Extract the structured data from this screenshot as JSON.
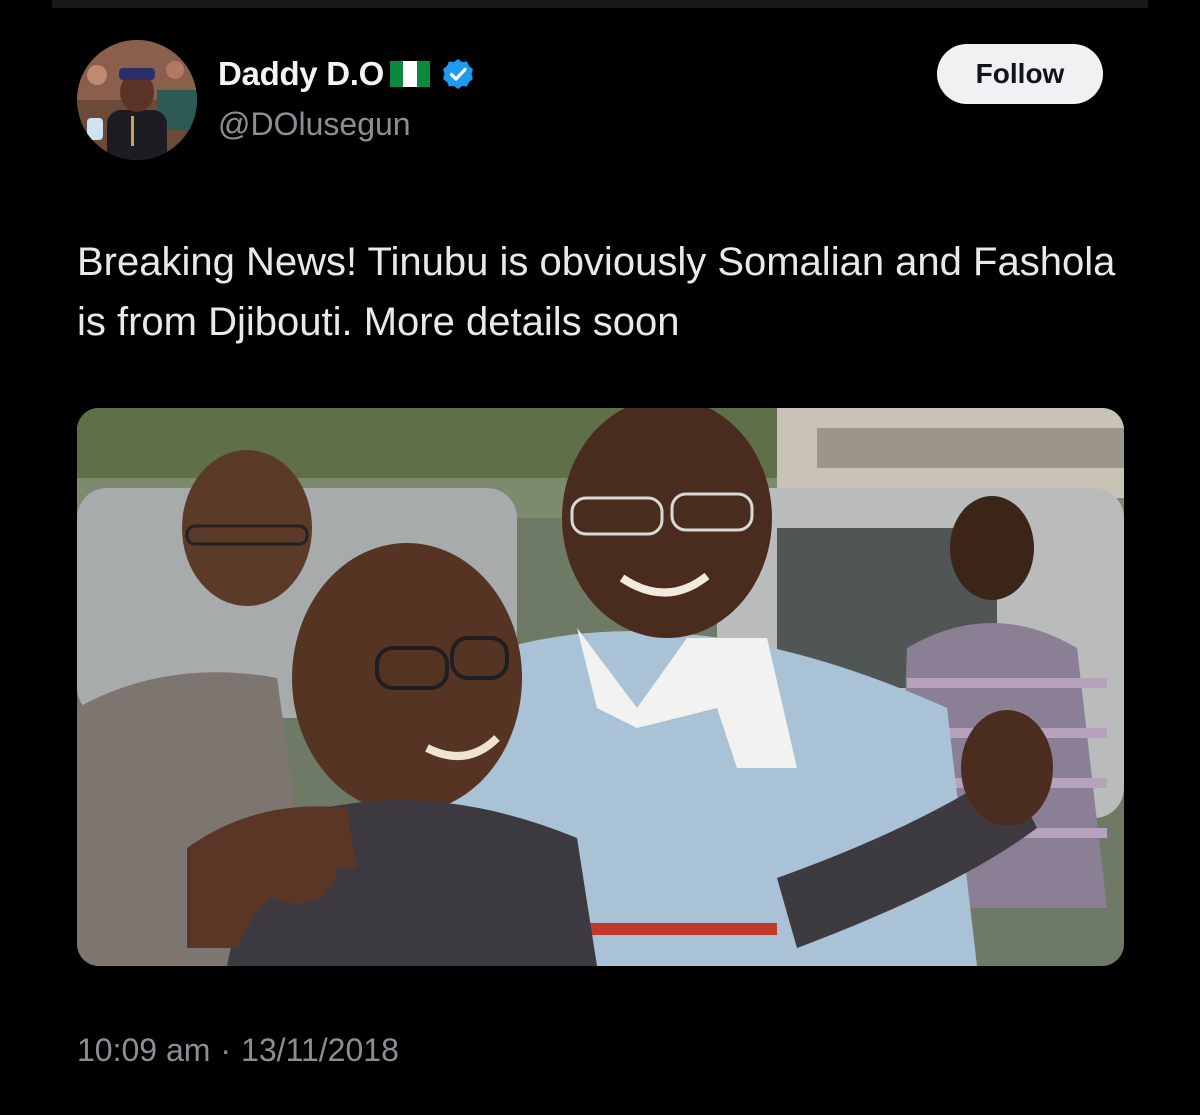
{
  "tweet": {
    "display_name": "Daddy D.O",
    "handle": "@DOlusegun",
    "flag_icon": "nigeria-flag-icon",
    "verified_icon": "verified-badge-icon",
    "verified_color": "#1d9bf0",
    "follow_label": "Follow",
    "text": "Breaking News! Tinubu is obviously Somalian and Fashola is from Djibouti. More details soon",
    "time": "10:09 am",
    "separator": "·",
    "date": "13/11/2018"
  }
}
